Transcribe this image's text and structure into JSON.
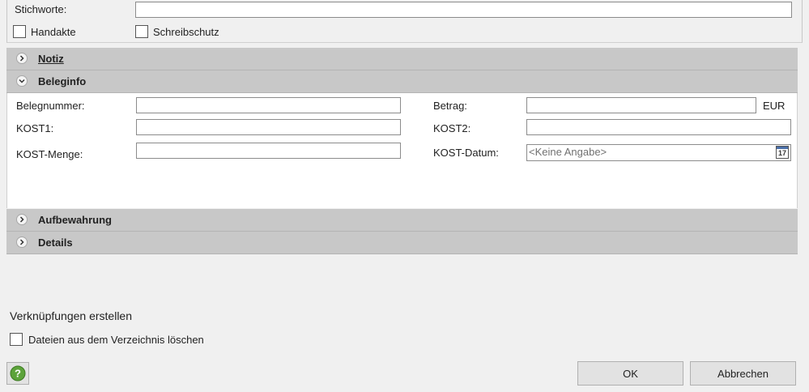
{
  "top": {
    "stichworte_label": "Stichworte:",
    "stichworte_value": "",
    "handakte_label": "Handakte",
    "schreibschutz_label": "Schreibschutz"
  },
  "sections": {
    "notiz": "Notiz",
    "beleginfo": "Beleginfo",
    "aufbewahrung": "Aufbewahrung",
    "details": "Details"
  },
  "beleginfo": {
    "belegnummer_label": "Belegnummer:",
    "betrag_label": "Betrag:",
    "currency": "EUR",
    "kost1_label": "KOST1:",
    "kost2_label": "KOST2:",
    "kost_menge_label": "KOST-Menge:",
    "kost_datum_label": "KOST-Datum:",
    "kost_datum_value": "<Keine Angabe>",
    "calendar_day": "17"
  },
  "footer": {
    "links_heading": "Verknüpfungen erstellen",
    "delete_files_label": "Dateien aus dem Verzeichnis löschen",
    "ok_label": "OK",
    "cancel_label": "Abbrechen"
  }
}
